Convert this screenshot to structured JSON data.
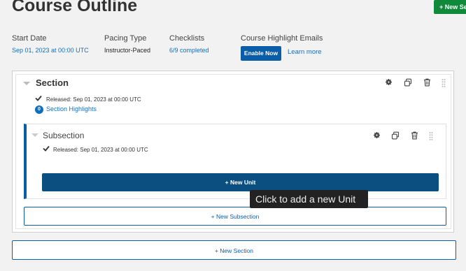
{
  "header": {
    "title": "Course Outline",
    "new_section_button": "+ New Se"
  },
  "info": {
    "start_date": {
      "label": "Start Date",
      "value": "Sep 01, 2023 at 00:00 UTC"
    },
    "pacing_type": {
      "label": "Pacing Type",
      "value": "Instructor-Paced"
    },
    "checklists": {
      "label": "Checklists",
      "value": "6/9 completed"
    },
    "highlight_emails": {
      "label": "Course Highlight Emails",
      "enable_button": "Enable Now",
      "learn_more": "Learn more"
    }
  },
  "section": {
    "title": "Section",
    "released": "Released: Sep 01, 2023 at 00:00 UTC",
    "highlights_count": "0",
    "highlights_label": "Section Highlights",
    "subsection": {
      "title": "Subsection",
      "released": "Released: Sep 01, 2023 at 00:00 UTC",
      "new_unit_button": "+   New Unit"
    },
    "new_subsection_button": "+   New Subsection"
  },
  "new_section_bottom_button": "+   New Section",
  "tooltip": "Click to add a new Unit",
  "colors": {
    "accent": "#0a5ea8",
    "link": "#0f6fbe",
    "success": "#0e8a3a",
    "tooltip_bg": "#222222"
  },
  "icons": [
    "gear-icon",
    "duplicate-icon",
    "trash-icon",
    "drag-handle-icon",
    "chevron-down-icon",
    "checkmark-icon"
  ]
}
